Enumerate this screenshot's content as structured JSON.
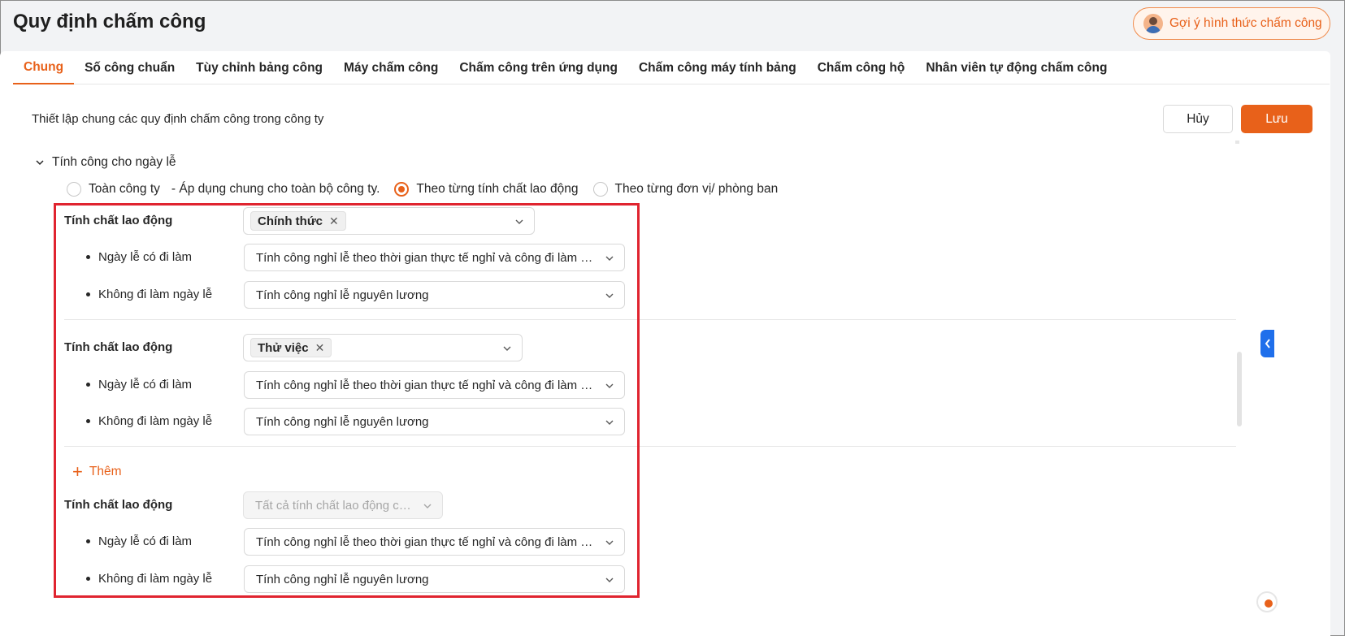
{
  "page": {
    "title": "Quy định chấm công",
    "suggest_button": "Gợi ý hình thức chấm công"
  },
  "tabs": [
    {
      "label": "Chung",
      "active": true
    },
    {
      "label": "Số công chuẩn"
    },
    {
      "label": "Tùy chỉnh bảng công"
    },
    {
      "label": "Máy chấm công"
    },
    {
      "label": "Chấm công trên ứng dụng"
    },
    {
      "label": "Chấm công máy tính bảng"
    },
    {
      "label": "Chấm công hộ"
    },
    {
      "label": "Nhân viên tự động chấm công"
    }
  ],
  "section": {
    "description": "Thiết lập chung các quy định chấm công trong công ty",
    "cancel_label": "Hủy",
    "save_label": "Lưu"
  },
  "holiday": {
    "header": "Tính công cho ngày lễ",
    "options": [
      {
        "label": "Toàn công ty",
        "checked": false
      },
      {
        "label": "- Áp dụng chung cho toàn bộ công ty."
      },
      {
        "label": "Theo từng tính chất lao động",
        "checked": true
      },
      {
        "label": "Theo từng đơn vị/ phòng ban",
        "checked": false
      }
    ],
    "groups": [
      {
        "type_label": "Tính chất lao động",
        "tag": "Chính thức",
        "work_label": "Ngày lễ có đi làm",
        "work_value": "Tính công nghỉ lễ theo thời gian thực tế nghỉ và công đi làm ngà...",
        "off_label": "Không đi làm ngày lễ",
        "off_value": "Tính công nghỉ lễ nguyên lương"
      },
      {
        "type_label": "Tính chất lao động",
        "tag": "Thử việc",
        "work_label": "Ngày lễ có đi làm",
        "work_value": "Tính công nghỉ lễ theo thời gian thực tế nghỉ và công đi làm ngà...",
        "off_label": "Không đi làm ngày lễ",
        "off_value": "Tính công nghỉ lễ nguyên lương"
      },
      {
        "type_label": "Tính chất lao động",
        "placeholder": "Tất cả tính chất lao động cò...",
        "work_label": "Ngày lễ có đi làm",
        "work_value": "Tính công nghỉ lễ theo thời gian thực tế nghỉ và công đi làm ngà...",
        "off_label": "Không đi làm ngày lễ",
        "off_value": "Tính công nghỉ lễ nguyên lương"
      }
    ],
    "add_label": "Thêm"
  },
  "colors": {
    "accent": "#e8611a",
    "highlight": "#e0242f",
    "side_toggle": "#1f6feb"
  },
  "icons": [
    "avatar-icon",
    "chevron-down-icon",
    "close-icon",
    "plus-icon",
    "chevron-left-icon"
  ]
}
